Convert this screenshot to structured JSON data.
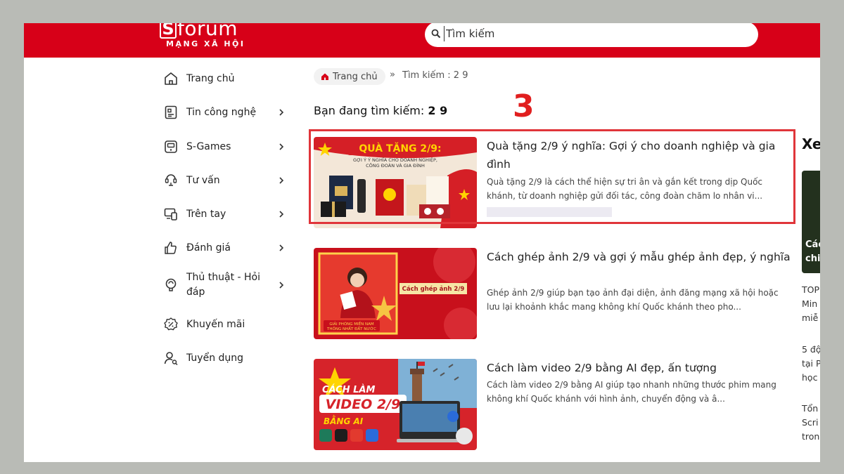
{
  "header": {
    "logo_mark": "S",
    "logo_word": "forum",
    "logo_sub": "MẠNG XÃ HỘI",
    "search_placeholder": "Tìm kiếm"
  },
  "sidebar": {
    "items": [
      {
        "label": "Trang chủ",
        "icon": "home-icon",
        "chevron": false
      },
      {
        "label": "Tin công nghệ",
        "icon": "news-icon",
        "chevron": true
      },
      {
        "label": "S-Games",
        "icon": "game-icon",
        "chevron": true
      },
      {
        "label": "Tư vấn",
        "icon": "consult-icon",
        "chevron": true
      },
      {
        "label": "Trên tay",
        "icon": "hands-on-icon",
        "chevron": true
      },
      {
        "label": "Đánh giá",
        "icon": "review-icon",
        "chevron": true
      },
      {
        "label": "Thủ thuật - Hỏi đáp",
        "icon": "tips-icon",
        "chevron": true
      },
      {
        "label": "Khuyến mãi",
        "icon": "promo-icon",
        "chevron": false
      },
      {
        "label": "Tuyển dụng",
        "icon": "recruit-icon",
        "chevron": false
      }
    ]
  },
  "breadcrumb": {
    "home": "Trang chủ",
    "sep": "»",
    "current": "Tìm kiếm : 2 9"
  },
  "search_result": {
    "label": "Bạn đang tìm kiếm:",
    "query": "2 9"
  },
  "annotation": {
    "number": "3",
    "color": "#e0353a"
  },
  "articles": [
    {
      "title": "Quà tặng 2/9 ý nghĩa: Gợi ý cho doanh nghiệp và gia đình",
      "desc": "Quà tặng 2/9 là cách thể hiện sự tri ân và gắn kết trong dịp Quốc khánh, từ doanh nghiệp gửi đối tác, công đoàn chăm lo nhân vi...",
      "thumb": {
        "line1": "QUÀ TẶNG 2/9:",
        "line2": "GỢI Ý Ý NGHĨA CHO DOANH NGHIỆP,",
        "line3": "CÔNG ĐOÀN VÀ GIA ĐÌNH"
      }
    },
    {
      "title": "Cách ghép ảnh 2/9 và gợi ý mẫu ghép ảnh đẹp, ý nghĩa",
      "desc": "Ghép ảnh 2/9 giúp bạn tạo ảnh đại diện, ảnh đăng mạng xã hội hoặc lưu lại khoảnh khắc mang không khí Quốc khánh theo pho...",
      "thumb": {
        "tag": "Cách ghép ảnh 2/9",
        "banner": "GIẢI PHÓNG MIỀN NAM\nTHỐNG NHẤT ĐẤT NƯỚC"
      }
    },
    {
      "title": "Cách làm video 2/9 bằng AI đẹp, ấn tượng",
      "desc": "Cách làm video 2/9 bằng AI giúp tạo nhanh những thước phim mang không khí Quốc khánh với hình ảnh, chuyển động và â...",
      "thumb": {
        "line1": "CÁCH LÀM",
        "line2": "VIDEO 2/9",
        "line3": "BẰNG AI"
      }
    }
  ],
  "right_column": {
    "title": "Xe",
    "card_text": "Các\nchi",
    "items": [
      "TOP\nMin\nmiễ",
      "5 độ\ntại P\nhọc",
      "Tổn\nScri\ntron"
    ]
  },
  "colors": {
    "brand": "#d70018",
    "background": "#b9bbb6"
  }
}
